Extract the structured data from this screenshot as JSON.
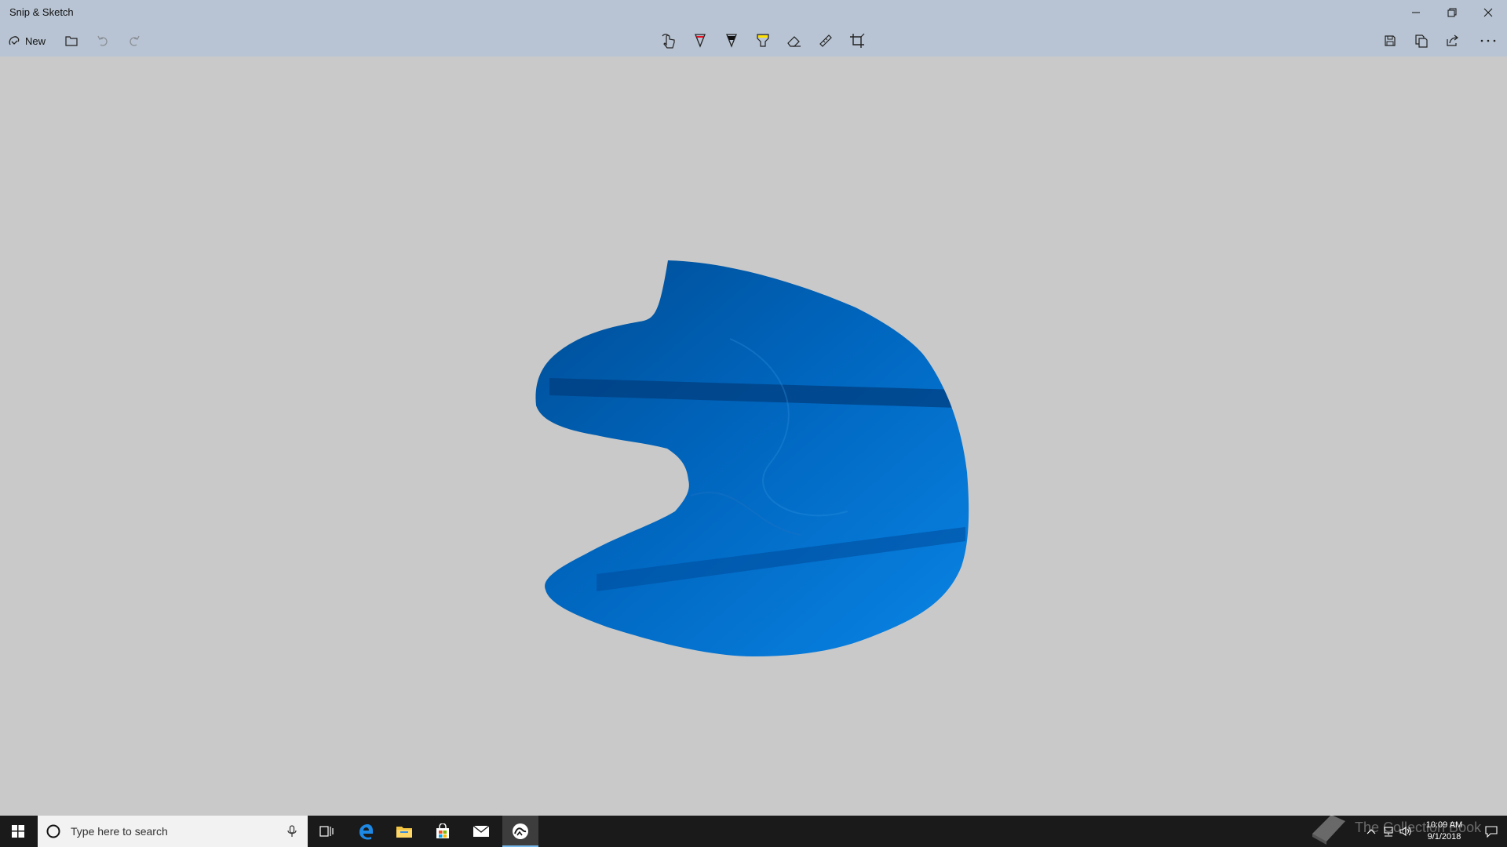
{
  "window": {
    "title": "Snip & Sketch"
  },
  "toolbar": {
    "new_label": "New",
    "active_tool": "ballpoint-pen",
    "colors": {
      "ballpoint_pen": "#e81123",
      "pencil": "#111111",
      "highlighter": "#ffe000",
      "accent": "#0063b1"
    }
  },
  "canvas": {
    "background": "#c9c9c9",
    "snip_fill": "#0078d7"
  },
  "taskbar": {
    "search_placeholder": "Type here to search",
    "pinned_apps": [
      "task-view",
      "edge",
      "file-explorer",
      "store",
      "mail",
      "snip-and-sketch"
    ],
    "active_app": "snip-and-sketch"
  },
  "watermark": {
    "text": "The Collection Book"
  },
  "clock": {
    "time": "10:09 AM",
    "date": "9/1/2018"
  }
}
